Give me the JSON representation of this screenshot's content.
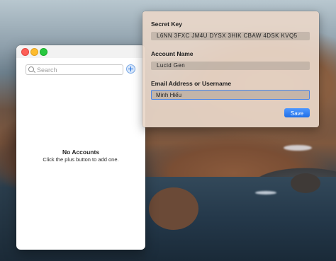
{
  "main_window": {
    "search": {
      "placeholder": "Search",
      "value": ""
    },
    "empty_state": {
      "title": "No Accounts",
      "subtitle": "Click the plus button to add one."
    }
  },
  "popover": {
    "secret_key_label": "Secret Key",
    "secret_key_value": "L6NN 3FXC JM4U DYSX 3HIK CBAW 4DSK KVQ5",
    "account_name_label": "Account Name",
    "account_name_value": "Lucid Gen",
    "email_label": "Email Address or Username",
    "email_value": "Minh Hiếu",
    "save_label": "Save"
  }
}
